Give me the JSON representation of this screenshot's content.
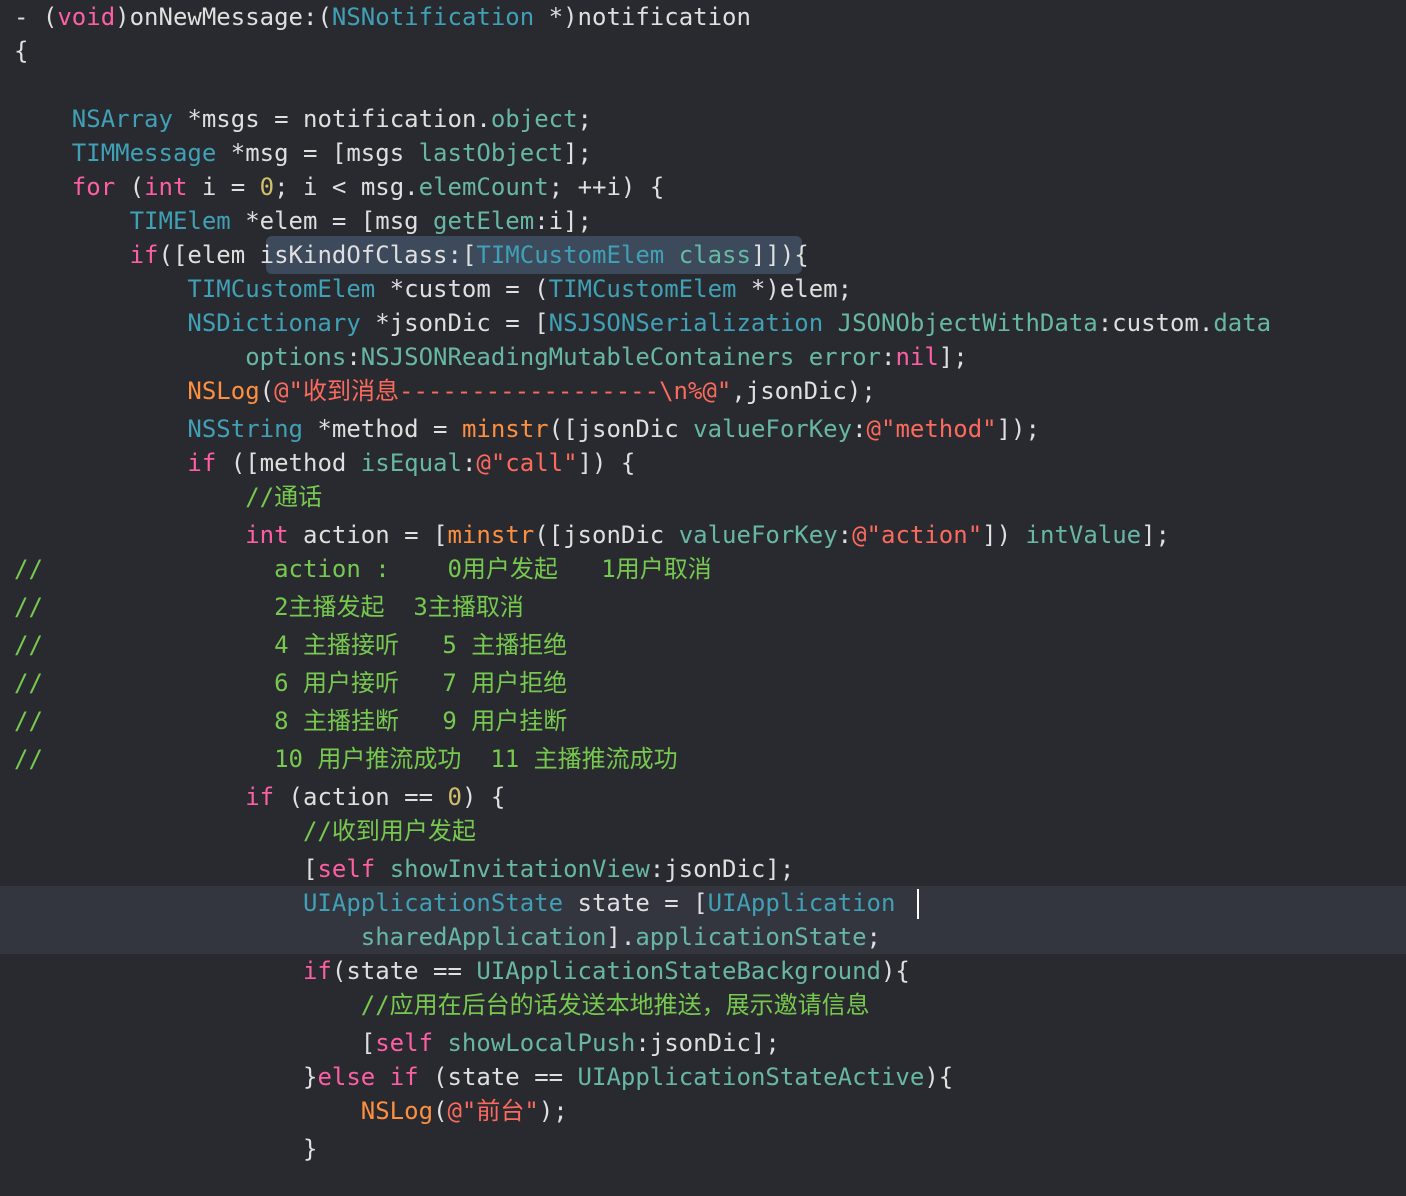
{
  "editor": {
    "lines": [
      [
        [
          "pln",
          "- ("
        ],
        [
          "kw",
          "void"
        ],
        [
          "pln",
          ")onNewMessage:("
        ],
        [
          "cls",
          "NSNotification"
        ],
        [
          "pln",
          " *)notification"
        ]
      ],
      [
        [
          "pln",
          "{"
        ]
      ],
      [],
      [
        [
          "pln",
          "    "
        ],
        [
          "cls",
          "NSArray"
        ],
        [
          "pln",
          " *msgs = notification."
        ],
        [
          "mth",
          "object"
        ],
        [
          "pln",
          ";"
        ]
      ],
      [
        [
          "pln",
          "    "
        ],
        [
          "cls",
          "TIMMessage"
        ],
        [
          "pln",
          " *msg = [msgs "
        ],
        [
          "mth",
          "lastObject"
        ],
        [
          "pln",
          "];"
        ]
      ],
      [
        [
          "pln",
          "    "
        ],
        [
          "kw",
          "for"
        ],
        [
          "pln",
          " ("
        ],
        [
          "kw",
          "int"
        ],
        [
          "pln",
          " i = "
        ],
        [
          "num",
          "0"
        ],
        [
          "pln",
          "; i < msg."
        ],
        [
          "mth",
          "elemCount"
        ],
        [
          "pln",
          "; ++i) {"
        ]
      ],
      [
        [
          "pln",
          "        "
        ],
        [
          "cls",
          "TIMElem"
        ],
        [
          "pln",
          " *elem = [msg "
        ],
        [
          "mth",
          "getElem"
        ],
        [
          "pln",
          ":i];"
        ]
      ],
      [
        [
          "pln",
          "        "
        ],
        [
          "kw",
          "if"
        ],
        [
          "pln",
          "([elem "
        ],
        [
          "pln",
          "isKindOfClass:"
        ],
        [
          "pln",
          "["
        ],
        [
          "cls",
          "TIMCustomElem"
        ],
        [
          "pln",
          " "
        ],
        [
          "mth",
          "class"
        ],
        [
          "pln",
          "]]){"
        ]
      ],
      [
        [
          "pln",
          "            "
        ],
        [
          "cls",
          "TIMCustomElem"
        ],
        [
          "pln",
          " *custom = ("
        ],
        [
          "cls",
          "TIMCustomElem"
        ],
        [
          "pln",
          " *)elem;"
        ]
      ],
      [
        [
          "pln",
          "            "
        ],
        [
          "cls",
          "NSDictionary"
        ],
        [
          "pln",
          " *jsonDic = ["
        ],
        [
          "cls",
          "NSJSONSerialization"
        ],
        [
          "pln",
          " "
        ],
        [
          "mth",
          "JSONObjectWithData"
        ],
        [
          "pln",
          ":custom."
        ],
        [
          "mth",
          "data"
        ]
      ],
      [
        [
          "pln",
          "                "
        ],
        [
          "mth",
          "options"
        ],
        [
          "pln",
          ":"
        ],
        [
          "mth",
          "NSJSONReadingMutableContainers"
        ],
        [
          "pln",
          " "
        ],
        [
          "mth",
          "error"
        ],
        [
          "pln",
          ":"
        ],
        [
          "kw",
          "nil"
        ],
        [
          "pln",
          "];"
        ]
      ],
      [
        [
          "pln",
          "            "
        ],
        [
          "mac",
          "NSLog"
        ],
        [
          "pln",
          "("
        ],
        [
          "str",
          "@\"收到消息------------------\\n%@\""
        ],
        [
          "pln",
          ",jsonDic);"
        ]
      ],
      [
        [
          "pln",
          "            "
        ],
        [
          "cls",
          "NSString"
        ],
        [
          "pln",
          " *method = "
        ],
        [
          "mac",
          "minstr"
        ],
        [
          "pln",
          "([jsonDic "
        ],
        [
          "mth",
          "valueForKey"
        ],
        [
          "pln",
          ":"
        ],
        [
          "str",
          "@\"method\""
        ],
        [
          "pln",
          "]);"
        ]
      ],
      [
        [
          "pln",
          "            "
        ],
        [
          "kw",
          "if"
        ],
        [
          "pln",
          " ([method "
        ],
        [
          "mth",
          "isEqual"
        ],
        [
          "pln",
          ":"
        ],
        [
          "str",
          "@\"call\""
        ],
        [
          "pln",
          "]) {"
        ]
      ],
      [
        [
          "pln",
          "                "
        ],
        [
          "grn",
          "//通话"
        ]
      ],
      [
        [
          "pln",
          "                "
        ],
        [
          "kw",
          "int"
        ],
        [
          "pln",
          " action = ["
        ],
        [
          "mac",
          "minstr"
        ],
        [
          "pln",
          "([jsonDic "
        ],
        [
          "mth",
          "valueForKey"
        ],
        [
          "pln",
          ":"
        ],
        [
          "str",
          "@\"action\""
        ],
        [
          "pln",
          "]) "
        ],
        [
          "mth",
          "intValue"
        ],
        [
          "pln",
          "];"
        ]
      ],
      [
        [
          "grn",
          "//                action :    0用户发起   1用户取消"
        ]
      ],
      [
        [
          "grn",
          "//                2主播发起  3主播取消"
        ]
      ],
      [
        [
          "grn",
          "//                4 主播接听   5 主播拒绝"
        ]
      ],
      [
        [
          "grn",
          "//                6 用户接听   7 用户拒绝"
        ]
      ],
      [
        [
          "grn",
          "//                8 主播挂断   9 用户挂断"
        ]
      ],
      [
        [
          "grn",
          "//                10 用户推流成功  11 主播推流成功"
        ]
      ],
      [
        [
          "pln",
          "                "
        ],
        [
          "kw",
          "if"
        ],
        [
          "pln",
          " (action == "
        ],
        [
          "num",
          "0"
        ],
        [
          "pln",
          ") {"
        ]
      ],
      [
        [
          "pln",
          "                    "
        ],
        [
          "grn",
          "//收到用户发起"
        ]
      ],
      [
        [
          "pln",
          "                    ["
        ],
        [
          "kw",
          "self"
        ],
        [
          "pln",
          " "
        ],
        [
          "mth",
          "showInvitationView"
        ],
        [
          "pln",
          ":jsonDic];"
        ]
      ],
      [
        [
          "pln",
          "                    "
        ],
        [
          "cls",
          "UIApplicationState"
        ],
        [
          "pln",
          " state = ["
        ],
        [
          "cls",
          "UIApplication"
        ]
      ],
      [
        [
          "pln",
          "                        "
        ],
        [
          "mth",
          "sharedApplication"
        ],
        [
          "pln",
          "]."
        ],
        [
          "mth",
          "applicationState"
        ],
        [
          "pln",
          ";"
        ]
      ],
      [
        [
          "pln",
          "                    "
        ],
        [
          "kw",
          "if"
        ],
        [
          "pln",
          "(state == "
        ],
        [
          "mth",
          "UIApplicationStateBackground"
        ],
        [
          "pln",
          "){"
        ]
      ],
      [
        [
          "pln",
          "                        "
        ],
        [
          "grn",
          "//应用在后台的话发送本地推送，展示邀请信息"
        ]
      ],
      [
        [
          "pln",
          "                        ["
        ],
        [
          "kw",
          "self"
        ],
        [
          "pln",
          " "
        ],
        [
          "mth",
          "showLocalPush"
        ],
        [
          "pln",
          ":jsonDic];"
        ]
      ],
      [
        [
          "pln",
          "                    }"
        ],
        [
          "kw",
          "else"
        ],
        [
          "pln",
          " "
        ],
        [
          "kw",
          "if"
        ],
        [
          "pln",
          " (state == "
        ],
        [
          "mth",
          "UIApplicationStateActive"
        ],
        [
          "pln",
          "){"
        ]
      ],
      [
        [
          "pln",
          "                        "
        ],
        [
          "mac",
          "NSLog"
        ],
        [
          "pln",
          "("
        ],
        [
          "str",
          "@\"前台\""
        ],
        [
          "pln",
          ");"
        ]
      ],
      [
        [
          "pln",
          "                    }"
        ]
      ]
    ]
  }
}
